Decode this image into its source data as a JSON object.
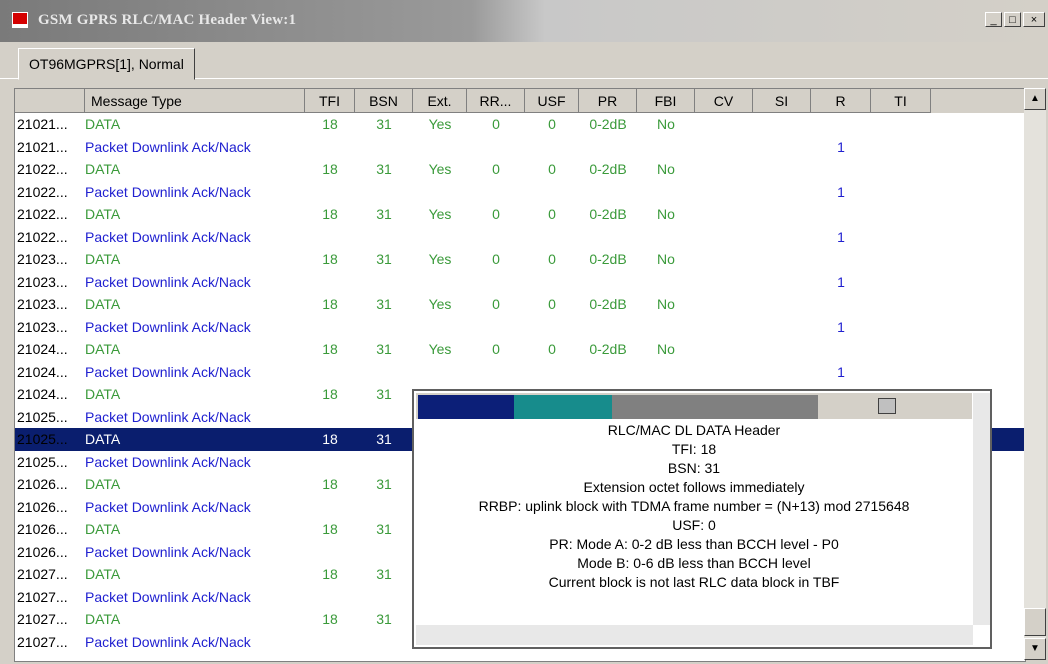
{
  "window": {
    "title": "GSM GPRS RLC/MAC Header View:1",
    "minimize": "_",
    "maximize": "□",
    "close": "×"
  },
  "tab": {
    "label": "OT96MGPRS[1], Normal"
  },
  "columns": [
    "Message Type",
    "TFI",
    "BSN",
    "Ext.",
    "RR...",
    "USF",
    "PR",
    "FBI",
    "CV",
    "SI",
    "R",
    "TI"
  ],
  "rows": [
    {
      "id": "21021...",
      "type": "DATA",
      "tfi": "18",
      "bsn": "31",
      "ext": "Yes",
      "rr": "0",
      "usf": "0",
      "pr": "0-2dB",
      "fbi": "No",
      "r": ""
    },
    {
      "id": "21021...",
      "type": "Packet Downlink Ack/Nack",
      "tfi": "",
      "bsn": "",
      "ext": "",
      "rr": "",
      "usf": "",
      "pr": "",
      "fbi": "",
      "r": "1"
    },
    {
      "id": "21022...",
      "type": "DATA",
      "tfi": "18",
      "bsn": "31",
      "ext": "Yes",
      "rr": "0",
      "usf": "0",
      "pr": "0-2dB",
      "fbi": "No",
      "r": ""
    },
    {
      "id": "21022...",
      "type": "Packet Downlink Ack/Nack",
      "tfi": "",
      "bsn": "",
      "ext": "",
      "rr": "",
      "usf": "",
      "pr": "",
      "fbi": "",
      "r": "1"
    },
    {
      "id": "21022...",
      "type": "DATA",
      "tfi": "18",
      "bsn": "31",
      "ext": "Yes",
      "rr": "0",
      "usf": "0",
      "pr": "0-2dB",
      "fbi": "No",
      "r": ""
    },
    {
      "id": "21022...",
      "type": "Packet Downlink Ack/Nack",
      "tfi": "",
      "bsn": "",
      "ext": "",
      "rr": "",
      "usf": "",
      "pr": "",
      "fbi": "",
      "r": "1"
    },
    {
      "id": "21023...",
      "type": "DATA",
      "tfi": "18",
      "bsn": "31",
      "ext": "Yes",
      "rr": "0",
      "usf": "0",
      "pr": "0-2dB",
      "fbi": "No",
      "r": ""
    },
    {
      "id": "21023...",
      "type": "Packet Downlink Ack/Nack",
      "tfi": "",
      "bsn": "",
      "ext": "",
      "rr": "",
      "usf": "",
      "pr": "",
      "fbi": "",
      "r": "1"
    },
    {
      "id": "21023...",
      "type": "DATA",
      "tfi": "18",
      "bsn": "31",
      "ext": "Yes",
      "rr": "0",
      "usf": "0",
      "pr": "0-2dB",
      "fbi": "No",
      "r": ""
    },
    {
      "id": "21023...",
      "type": "Packet Downlink Ack/Nack",
      "tfi": "",
      "bsn": "",
      "ext": "",
      "rr": "",
      "usf": "",
      "pr": "",
      "fbi": "",
      "r": "1"
    },
    {
      "id": "21024...",
      "type": "DATA",
      "tfi": "18",
      "bsn": "31",
      "ext": "Yes",
      "rr": "0",
      "usf": "0",
      "pr": "0-2dB",
      "fbi": "No",
      "r": ""
    },
    {
      "id": "21024...",
      "type": "Packet Downlink Ack/Nack",
      "tfi": "",
      "bsn": "",
      "ext": "",
      "rr": "",
      "usf": "",
      "pr": "",
      "fbi": "",
      "r": "1"
    },
    {
      "id": "21024...",
      "type": "DATA",
      "tfi": "18",
      "bsn": "31",
      "ext": "",
      "rr": "",
      "usf": "",
      "pr": "",
      "fbi": "",
      "r": ""
    },
    {
      "id": "21025...",
      "type": "Packet Downlink Ack/Nack",
      "tfi": "",
      "bsn": "",
      "ext": "",
      "rr": "",
      "usf": "",
      "pr": "",
      "fbi": "",
      "r": ""
    },
    {
      "id": "21025...",
      "type": "DATA",
      "tfi": "18",
      "bsn": "31",
      "ext": "",
      "rr": "",
      "usf": "",
      "pr": "",
      "fbi": "",
      "r": "",
      "selected": true
    },
    {
      "id": "21025...",
      "type": "Packet Downlink Ack/Nack",
      "tfi": "",
      "bsn": "",
      "ext": "",
      "rr": "",
      "usf": "",
      "pr": "",
      "fbi": "",
      "r": ""
    },
    {
      "id": "21026...",
      "type": "DATA",
      "tfi": "18",
      "bsn": "31",
      "ext": "",
      "rr": "",
      "usf": "",
      "pr": "",
      "fbi": "",
      "r": ""
    },
    {
      "id": "21026...",
      "type": "Packet Downlink Ack/Nack",
      "tfi": "",
      "bsn": "",
      "ext": "",
      "rr": "",
      "usf": "",
      "pr": "",
      "fbi": "",
      "r": ""
    },
    {
      "id": "21026...",
      "type": "DATA",
      "tfi": "18",
      "bsn": "31",
      "ext": "",
      "rr": "",
      "usf": "",
      "pr": "",
      "fbi": "",
      "r": ""
    },
    {
      "id": "21026...",
      "type": "Packet Downlink Ack/Nack",
      "tfi": "",
      "bsn": "",
      "ext": "",
      "rr": "",
      "usf": "",
      "pr": "",
      "fbi": "",
      "r": ""
    },
    {
      "id": "21027...",
      "type": "DATA",
      "tfi": "18",
      "bsn": "31",
      "ext": "",
      "rr": "",
      "usf": "",
      "pr": "",
      "fbi": "",
      "r": ""
    },
    {
      "id": "21027...",
      "type": "Packet Downlink Ack/Nack",
      "tfi": "",
      "bsn": "",
      "ext": "",
      "rr": "",
      "usf": "",
      "pr": "",
      "fbi": "",
      "r": ""
    },
    {
      "id": "21027...",
      "type": "DATA",
      "tfi": "18",
      "bsn": "31",
      "ext": "",
      "rr": "",
      "usf": "",
      "pr": "",
      "fbi": "",
      "r": ""
    },
    {
      "id": "21027...",
      "type": "Packet Downlink Ack/Nack",
      "tfi": "",
      "bsn": "",
      "ext": "",
      "rr": "",
      "usf": "",
      "pr": "",
      "fbi": "",
      "r": ""
    }
  ],
  "popup": {
    "lines": [
      "RLC/MAC DL DATA Header",
      "TFI: 18",
      "BSN: 31",
      "Extension octet follows immediately",
      "RRBP: uplink block with TDMA frame number = (N+13) mod 2715648",
      "USF: 0",
      "PR: Mode A: 0-2 dB less than BCCH level - P0",
      "Mode B: 0-6 dB less than BCCH level",
      "Current block is not last RLC data block in TBF"
    ],
    "segment_colors": [
      "#0c1f78",
      "#178c8c",
      "#808080"
    ],
    "close": "×"
  },
  "colors": {
    "data": "#3a9a3a",
    "ack": "#2020d0",
    "selected_bg": "#0a1e6e"
  }
}
